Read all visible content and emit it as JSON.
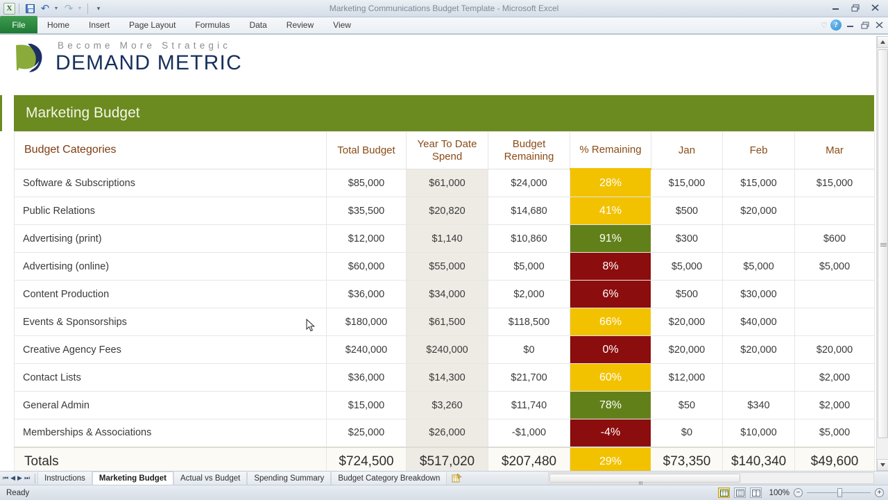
{
  "window": {
    "title": "Marketing Communications Budget Template  -  Microsoft Excel",
    "minimize_label": "–",
    "restore_label": "❐",
    "close_label": "✕"
  },
  "quick_access": {
    "excel_icon": "X",
    "save_label": "save-icon",
    "undo_label": "↶",
    "redo_label": "↷",
    "caret": "▾",
    "customize_label": "≡▾"
  },
  "ribbon": {
    "file_tab": "File",
    "tabs": [
      "Home",
      "Insert",
      "Page Layout",
      "Formulas",
      "Data",
      "Review",
      "View"
    ],
    "heart": "♡",
    "help": "?",
    "minimize_ribbon": "–",
    "restore_window": "❐",
    "close_window": "✕"
  },
  "logo": {
    "tagline": "Become More Strategic",
    "brand_first": "D",
    "brand_rest": "EMAND",
    "brand_second": "M",
    "brand_second_rest": "ETRIC",
    "brand_full": "DEMAND METRIC",
    "green": "#8aab3a",
    "navy": "#1d2f63"
  },
  "banner": {
    "title": "Marketing Budget",
    "bg": "#6b8a1f",
    "text_color": "#f2f6e6"
  },
  "table": {
    "headers": [
      "Budget Categories",
      "Total Budget",
      "Year To Date Spend",
      "Budget Remaining",
      "% Remaining",
      "Jan",
      "Feb",
      "Mar"
    ],
    "header_color": "#8a4b16",
    "rows": [
      {
        "category": "Software & Subscriptions",
        "total_budget": "$85,000",
        "ytd_spend": "$61,000",
        "budget_remaining": "$24,000",
        "pct_remaining": "28%",
        "pct_color": "#f2c200",
        "jan": "$15,000",
        "feb": "$15,000",
        "mar": "$15,000"
      },
      {
        "category": "Public Relations",
        "total_budget": "$35,500",
        "ytd_spend": "$20,820",
        "budget_remaining": "$14,680",
        "pct_remaining": "41%",
        "pct_color": "#f2c200",
        "jan": "$500",
        "feb": "$20,000",
        "mar": ""
      },
      {
        "category": "Advertising (print)",
        "total_budget": "$12,000",
        "ytd_spend": "$1,140",
        "budget_remaining": "$10,860",
        "pct_remaining": "91%",
        "pct_color": "#628019",
        "jan": "$300",
        "feb": "",
        "mar": "$600"
      },
      {
        "category": "Advertising (online)",
        "total_budget": "$60,000",
        "ytd_spend": "$55,000",
        "budget_remaining": "$5,000",
        "pct_remaining": "8%",
        "pct_color": "#8c0d0d",
        "jan": "$5,000",
        "feb": "$5,000",
        "mar": "$5,000"
      },
      {
        "category": "Content Production",
        "total_budget": "$36,000",
        "ytd_spend": "$34,000",
        "budget_remaining": "$2,000",
        "pct_remaining": "6%",
        "pct_color": "#8c0d0d",
        "jan": "$500",
        "feb": "$30,000",
        "mar": ""
      },
      {
        "category": "Events & Sponsorships",
        "total_budget": "$180,000",
        "ytd_spend": "$61,500",
        "budget_remaining": "$118,500",
        "pct_remaining": "66%",
        "pct_color": "#f2c200",
        "jan": "$20,000",
        "feb": "$40,000",
        "mar": ""
      },
      {
        "category": "Creative Agency Fees",
        "total_budget": "$240,000",
        "ytd_spend": "$240,000",
        "budget_remaining": "$0",
        "pct_remaining": "0%",
        "pct_color": "#8c0d0d",
        "jan": "$20,000",
        "feb": "$20,000",
        "mar": "$20,000"
      },
      {
        "category": "Contact Lists",
        "total_budget": "$36,000",
        "ytd_spend": "$14,300",
        "budget_remaining": "$21,700",
        "pct_remaining": "60%",
        "pct_color": "#f2c200",
        "jan": "$12,000",
        "feb": "",
        "mar": "$2,000"
      },
      {
        "category": "General Admin",
        "total_budget": "$15,000",
        "ytd_spend": "$3,260",
        "budget_remaining": "$11,740",
        "pct_remaining": "78%",
        "pct_color": "#628019",
        "jan": "$50",
        "feb": "$340",
        "mar": "$2,000"
      },
      {
        "category": "Memberships & Associations",
        "total_budget": "$25,000",
        "ytd_spend": "$26,000",
        "budget_remaining": "-$1,000",
        "pct_remaining": "-4%",
        "pct_color": "#8c0d0d",
        "jan": "$0",
        "feb": "$10,000",
        "mar": "$5,000"
      }
    ],
    "totals": {
      "category": "Totals",
      "total_budget": "$724,500",
      "ytd_spend": "$517,020",
      "budget_remaining": "$207,480",
      "pct_remaining": "29%",
      "pct_color": "#f2c200",
      "jan": "$73,350",
      "feb": "$140,340",
      "mar": "$49,600"
    }
  },
  "sheet_tabs": {
    "first_label": "⏮",
    "prev_label": "◀",
    "next_label": "▶",
    "last_label": "⏭",
    "tabs": [
      {
        "label": "Instructions",
        "active": false
      },
      {
        "label": "Marketing Budget",
        "active": true
      },
      {
        "label": "Actual vs Budget",
        "active": false
      },
      {
        "label": "Spending Summary",
        "active": false
      },
      {
        "label": "Budget Category Breakdown",
        "active": false
      }
    ],
    "new_sheet_label": "new-sheet-icon"
  },
  "status": {
    "ready": "Ready",
    "view_normal": "normal-view-icon",
    "view_page_layout": "page-layout-view-icon",
    "view_page_break": "page-break-view-icon",
    "zoom_level": "100%",
    "zoom_out": "−",
    "zoom_in": "+"
  }
}
